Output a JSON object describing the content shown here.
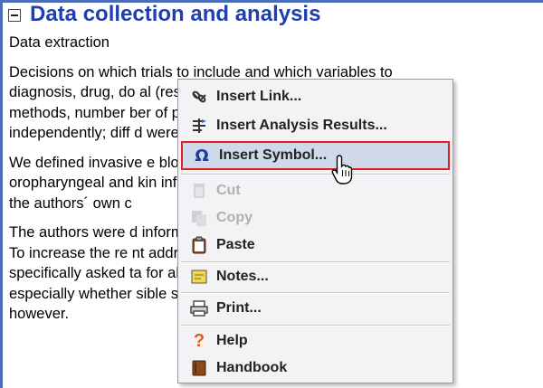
{
  "section": {
    "collapse_symbol": "minus",
    "title": "Data collection and analysis"
  },
  "subheading": "Data extraction",
  "paragraphs": [
    [
      "Decisions on which trials to include and which variables to",
      "diagnosis, drug, do                                          al (rescue)",
      "methods, number                                             ber of patie",
      "independently; diff                                          d were reso"
    ],
    [
      "We defined invasive                                       e blood cult",
      "oropharyngeal and                                         kin infection",
      "the authors´ own c"
    ],
    [
      "The authors were                                          d informat",
      "To increase the re                                        nt address",
      "specifically asked                                         ta for all ra",
      "especially whether                                        sible so th",
      "however."
    ]
  ],
  "context_menu": {
    "items": [
      {
        "label": "Insert Link...",
        "icon": "link-icon",
        "enabled": true
      },
      {
        "label": "Insert Analysis Results...",
        "icon": "analysis-results-icon",
        "enabled": true
      },
      {
        "label": "Insert Symbol...",
        "icon": "omega-symbol-icon",
        "enabled": true,
        "selected": true
      },
      {
        "label": "Cut",
        "icon": "scissors-icon",
        "enabled": false
      },
      {
        "label": "Copy",
        "icon": "copy-icon",
        "enabled": false
      },
      {
        "label": "Paste",
        "icon": "clipboard-icon",
        "enabled": true
      },
      {
        "label": "Notes...",
        "icon": "note-icon",
        "enabled": true
      },
      {
        "label": "Print...",
        "icon": "printer-icon",
        "enabled": true
      },
      {
        "label": "Help",
        "icon": "question-mark-icon",
        "enabled": true
      },
      {
        "label": "Handbook",
        "icon": "book-icon",
        "enabled": true
      }
    ]
  },
  "colors": {
    "title": "#1f3fb0",
    "frame_border": "#4a6db5",
    "selection_border": "#e02020",
    "selection_fill": "#cfd9ea",
    "disabled_text": "#b0b0b4"
  }
}
